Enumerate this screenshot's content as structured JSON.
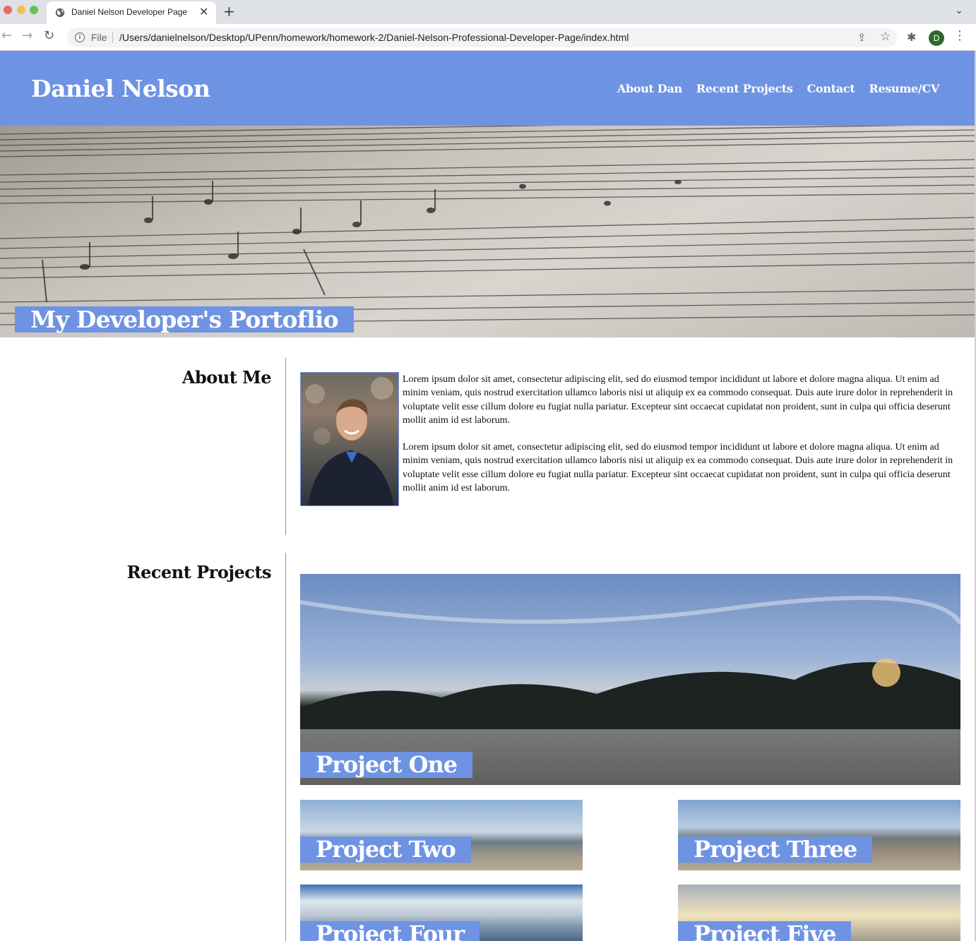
{
  "browser": {
    "tab_title": "Daniel Nelson Developer Page",
    "tab_close": "✕",
    "new_tab": "+",
    "tab_dropdown": "⌄",
    "back": "←",
    "forward": "→",
    "reload": "↻",
    "info": "i",
    "scheme": "File",
    "url": "/Users/danielnelson/Desktop/UPenn/homework/homework-2/Daniel-Nelson-Professional-Developer-Page/index.html",
    "share": "⇪",
    "star": "☆",
    "extensions": "✱",
    "profile_initial": "D",
    "menu": "⋮"
  },
  "header": {
    "name": "Daniel Nelson",
    "nav": [
      "About Dan",
      "Recent Projects",
      "Contact",
      "Resume/CV"
    ]
  },
  "hero": {
    "title": "My Developer's Portoflio"
  },
  "about": {
    "heading": "About Me",
    "paragraphs": [
      "Lorem ipsum dolor sit amet, consectetur adipiscing elit, sed do eiusmod tempor incididunt ut labore et dolore magna aliqua. Ut enim ad minim veniam, quis nostrud exercitation ullamco laboris nisi ut aliquip ex ea commodo consequat. Duis aute irure dolor in reprehenderit in voluptate velit esse cillum dolore eu fugiat nulla pariatur. Excepteur sint occaecat cupidatat non proident, sunt in culpa qui officia deserunt mollit anim id est laborum.",
      "Lorem ipsum dolor sit amet, consectetur adipiscing elit, sed do eiusmod tempor incididunt ut labore et dolore magna aliqua. Ut enim ad minim veniam, quis nostrud exercitation ullamco laboris nisi ut aliquip ex ea commodo consequat. Duis aute irure dolor in reprehenderit in voluptate velit esse cillum dolore eu fugiat nulla pariatur. Excepteur sint occaecat cupidatat non proident, sunt in culpa qui officia deserunt mollit anim id est laborum."
    ]
  },
  "projects": {
    "heading": "Recent Projects",
    "items": [
      "Project One",
      "Project Two",
      "Project Three",
      "Project Four",
      "Project Five"
    ]
  },
  "colors": {
    "accent": "#6f93e3",
    "text": "#111111",
    "background": "#ffffff"
  }
}
